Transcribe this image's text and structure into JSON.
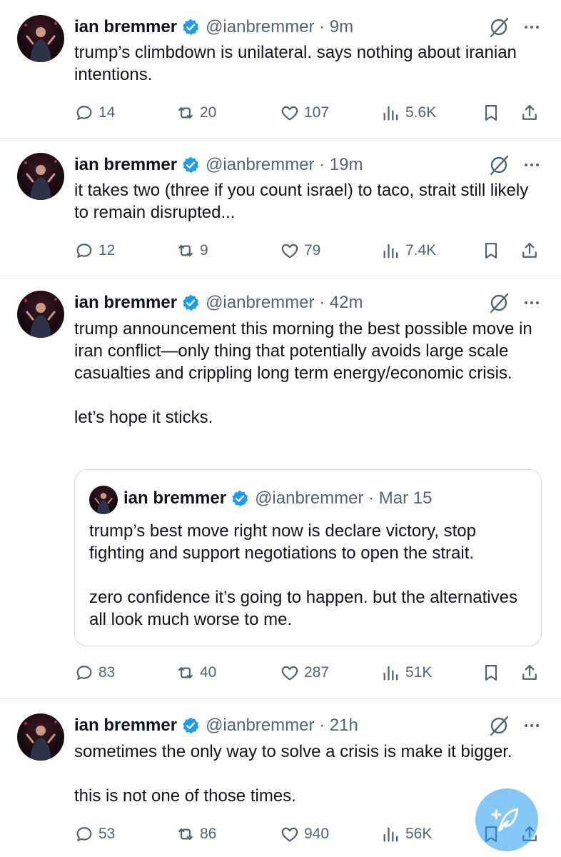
{
  "colors": {
    "accent": "#1d9bf0",
    "text": "#0f1419",
    "muted": "#536471",
    "divider": "#e7e9ea"
  },
  "icons": [
    "verified-badge-icon",
    "grok-icon",
    "more-icon",
    "reply-icon",
    "retweet-icon",
    "like-icon",
    "views-icon",
    "bookmark-icon",
    "share-icon",
    "compose-icon"
  ],
  "tweets": [
    {
      "name": "ian bremmer",
      "handle": "@ianbremmer · 9m",
      "lines": [
        "trump’s climbdown is unilateral. says nothing about iranian intentions."
      ],
      "replies": "14",
      "retweets": "20",
      "likes": "107",
      "views": "5.6K"
    },
    {
      "name": "ian bremmer",
      "handle": "@ianbremmer · 19m",
      "lines": [
        "it takes two (three if you count israel) to taco, strait still likely to remain disrupted..."
      ],
      "replies": "12",
      "retweets": "9",
      "likes": "79",
      "views": "7.4K"
    },
    {
      "name": "ian bremmer",
      "handle": "@ianbremmer · 42m",
      "lines": [
        "trump announcement this morning the best possible move in iran conflict—only thing that potentially avoids large scale casualties and crippling long term energy/economic crisis.",
        "let’s hope it sticks."
      ],
      "quote": {
        "name": "ian bremmer",
        "handle": "@ianbremmer · Mar 15",
        "lines": [
          "trump’s best move right now is declare victory, stop fighting and support negotiations to open the strait.",
          "zero confidence it’s going to happen. but the alternatives all look much worse to me."
        ]
      },
      "replies": "83",
      "retweets": "40",
      "likes": "287",
      "views": "51K"
    },
    {
      "name": "ian bremmer",
      "handle": "@ianbremmer · 21h",
      "lines": [
        "sometimes the only way to solve a crisis is make it bigger.",
        "this is not one of those times."
      ],
      "replies": "53",
      "retweets": "86",
      "likes": "940",
      "views": "56K"
    }
  ]
}
